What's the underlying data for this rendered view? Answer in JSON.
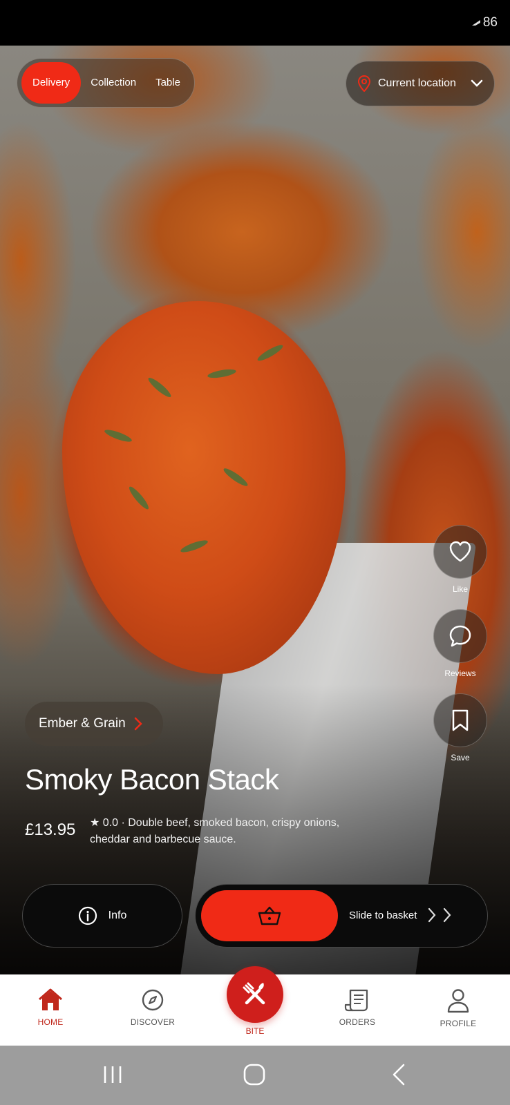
{
  "status_bar": {
    "battery": "86"
  },
  "mode_toggle": {
    "options": [
      "Delivery",
      "Collection",
      "Table"
    ],
    "active": "Delivery"
  },
  "location": {
    "label": "Current location"
  },
  "side_actions": {
    "like": "Like",
    "reviews": "Reviews",
    "save": "Save"
  },
  "restaurant": {
    "name": "Ember & Grain"
  },
  "dish": {
    "title": "Smoky Bacon Stack",
    "price": "£13.95",
    "description": "★ 0.0 · Double beef, smoked bacon, crispy onions, cheddar and barbecue sauce."
  },
  "actions": {
    "info": "Info",
    "slide_to_basket": "Slide to basket"
  },
  "bottom_nav": {
    "home": "HOME",
    "discover": "DISCOVER",
    "bite": "BITE",
    "orders": "ORDERS",
    "profile": "PROFILE"
  },
  "colors": {
    "accent": "#f02a16",
    "nav_active": "#c0281c"
  },
  "icons": [
    "location-pin-icon",
    "chevron-down-icon",
    "heart-icon",
    "chat-icon",
    "bookmark-icon",
    "chevron-right-icon",
    "info-icon",
    "basket-icon",
    "home-icon",
    "compass-icon",
    "fork-knife-icon",
    "receipt-icon",
    "user-icon",
    "recents-icon",
    "home-circle-icon",
    "back-icon"
  ]
}
